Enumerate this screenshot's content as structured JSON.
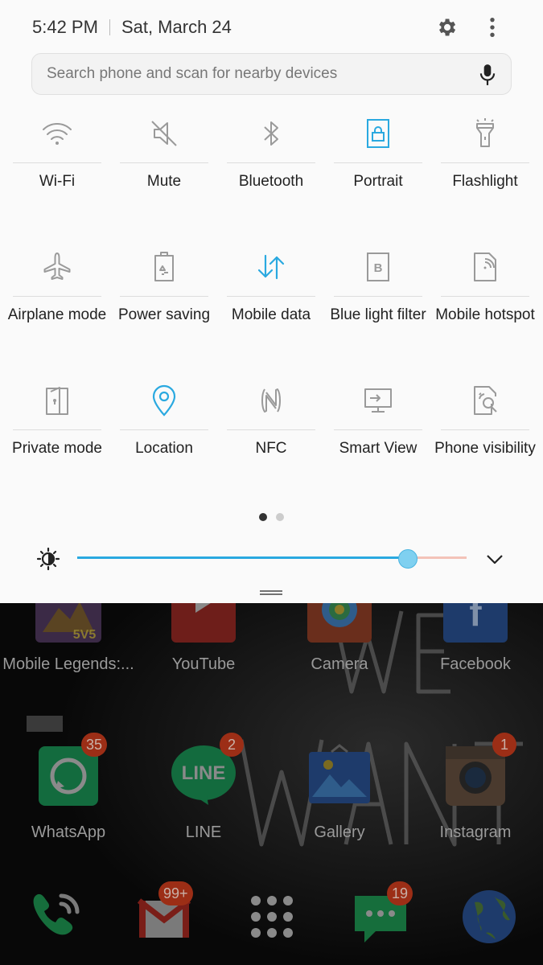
{
  "status": {
    "time": "5:42 PM",
    "date": "Sat, March 24"
  },
  "search": {
    "placeholder": "Search phone and scan for nearby devices"
  },
  "tiles": [
    {
      "label": "Wi-Fi",
      "icon": "wifi-icon",
      "active": false
    },
    {
      "label": "Mute",
      "icon": "mute-icon",
      "active": false
    },
    {
      "label": "Bluetooth",
      "icon": "bluetooth-icon",
      "active": false
    },
    {
      "label": "Portrait",
      "icon": "portrait-lock-icon",
      "active": true
    },
    {
      "label": "Flashlight",
      "icon": "flashlight-icon",
      "active": false
    },
    {
      "label": "Airplane mode",
      "icon": "airplane-icon",
      "active": false
    },
    {
      "label": "Power saving",
      "icon": "battery-recycle-icon",
      "active": false
    },
    {
      "label": "Mobile data",
      "icon": "data-arrows-icon",
      "active": true
    },
    {
      "label": "Blue light filter",
      "icon": "blue-light-icon",
      "active": false
    },
    {
      "label": "Mobile hotspot",
      "icon": "hotspot-icon",
      "active": false
    },
    {
      "label": "Private mode",
      "icon": "private-mode-icon",
      "active": false
    },
    {
      "label": "Location",
      "icon": "location-pin-icon",
      "active": true
    },
    {
      "label": "NFC",
      "icon": "nfc-icon",
      "active": false
    },
    {
      "label": "Smart View",
      "icon": "smart-view-icon",
      "active": false
    },
    {
      "label": "Phone visibility",
      "icon": "phone-visibility-icon",
      "active": false
    }
  ],
  "pager": {
    "pages": 2,
    "current": 1
  },
  "brightness": {
    "level": 0.85
  },
  "home_apps": [
    {
      "label": "Mobile Legends:...",
      "icon": "mobile-legends-icon",
      "badge": ""
    },
    {
      "label": "YouTube",
      "icon": "youtube-icon",
      "badge": ""
    },
    {
      "label": "Camera",
      "icon": "camera-icon",
      "badge": ""
    },
    {
      "label": "Facebook",
      "icon": "facebook-icon",
      "badge": ""
    },
    {
      "label": "WhatsApp",
      "icon": "whatsapp-icon",
      "badge": "35"
    },
    {
      "label": "LINE",
      "icon": "line-icon",
      "badge": "2"
    },
    {
      "label": "Gallery",
      "icon": "gallery-icon",
      "badge": ""
    },
    {
      "label": "Instagram",
      "icon": "instagram-icon",
      "badge": "1"
    }
  ],
  "dock": [
    {
      "icon": "phone-icon",
      "badge": ""
    },
    {
      "icon": "gmail-icon",
      "badge": "99+"
    },
    {
      "icon": "apps-grid-icon",
      "badge": ""
    },
    {
      "icon": "messages-icon",
      "badge": "19"
    },
    {
      "icon": "internet-globe-icon",
      "badge": ""
    }
  ],
  "colors": {
    "accent": "#2aa9e0",
    "icon_inactive": "#9a9a9a",
    "slider_rest": "#f3c3b8"
  }
}
